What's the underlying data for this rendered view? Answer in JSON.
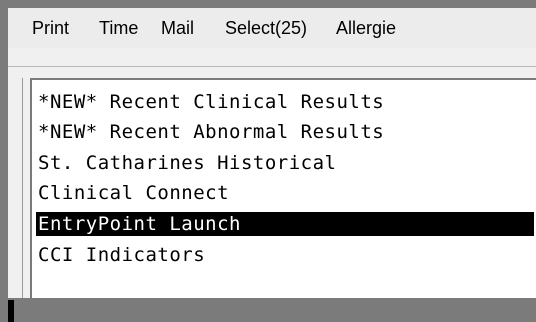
{
  "menubar": {
    "items": [
      {
        "label": "Print"
      },
      {
        "label": "Time"
      },
      {
        "label": "Mail"
      },
      {
        "label": "Select(25)"
      },
      {
        "label": "Allergie"
      }
    ]
  },
  "list": {
    "items": [
      {
        "label": "*NEW* Recent Clinical Results",
        "selected": false
      },
      {
        "label": "*NEW* Recent Abnormal Results",
        "selected": false
      },
      {
        "label": "St. Catharines Historical",
        "selected": false
      },
      {
        "label": "Clinical Connect",
        "selected": false
      },
      {
        "label": "EntryPoint Launch",
        "selected": true
      },
      {
        "label": "CCI Indicators",
        "selected": false
      }
    ]
  }
}
